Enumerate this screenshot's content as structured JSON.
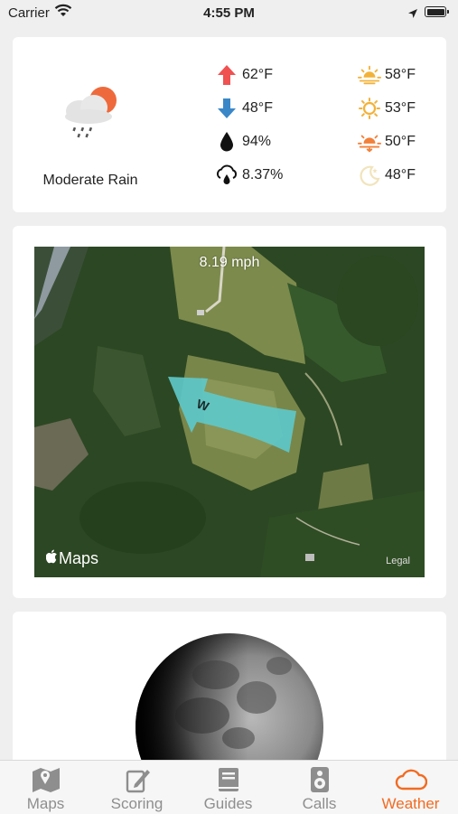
{
  "status_bar": {
    "carrier": "Carrier",
    "time": "4:55 PM"
  },
  "weather": {
    "condition_icon": "cloud-rain-sun-icon",
    "condition": "Moderate Rain",
    "left_stats": [
      {
        "icon": "arrow-up-icon",
        "color": "#f05151",
        "value": "62°F"
      },
      {
        "icon": "arrow-down-icon",
        "color": "#3a87c8",
        "value": "48°F"
      },
      {
        "icon": "humidity-drop-icon",
        "color": "#111111",
        "value": "94%"
      },
      {
        "icon": "precipitation-cloud-icon",
        "color": "#111111",
        "value": "8.37%"
      }
    ],
    "right_stats": [
      {
        "icon": "sunrise-icon",
        "color": "#f2b23a",
        "value": "58°F"
      },
      {
        "icon": "sun-icon",
        "color": "#f2b23a",
        "value": "53°F"
      },
      {
        "icon": "sunset-icon",
        "color": "#f2803a",
        "value": "50°F"
      },
      {
        "icon": "moon-icon",
        "color": "#f1e4bd",
        "value": "48°F"
      }
    ]
  },
  "map": {
    "wind_speed": "8.19 mph",
    "wind_direction": "W",
    "brand": "Maps",
    "legal": "Legal"
  },
  "tabs": [
    {
      "label": "Maps",
      "icon": "map-icon",
      "active": false
    },
    {
      "label": "Scoring",
      "icon": "scoring-pen-icon",
      "active": false
    },
    {
      "label": "Guides",
      "icon": "book-icon",
      "active": false
    },
    {
      "label": "Calls",
      "icon": "speaker-icon",
      "active": false
    },
    {
      "label": "Weather",
      "icon": "cloud-icon",
      "active": true
    }
  ],
  "colors": {
    "accent": "#f26b21",
    "tab_inactive": "#8e8e8e",
    "wind_arrow": "#5ec8c8"
  }
}
